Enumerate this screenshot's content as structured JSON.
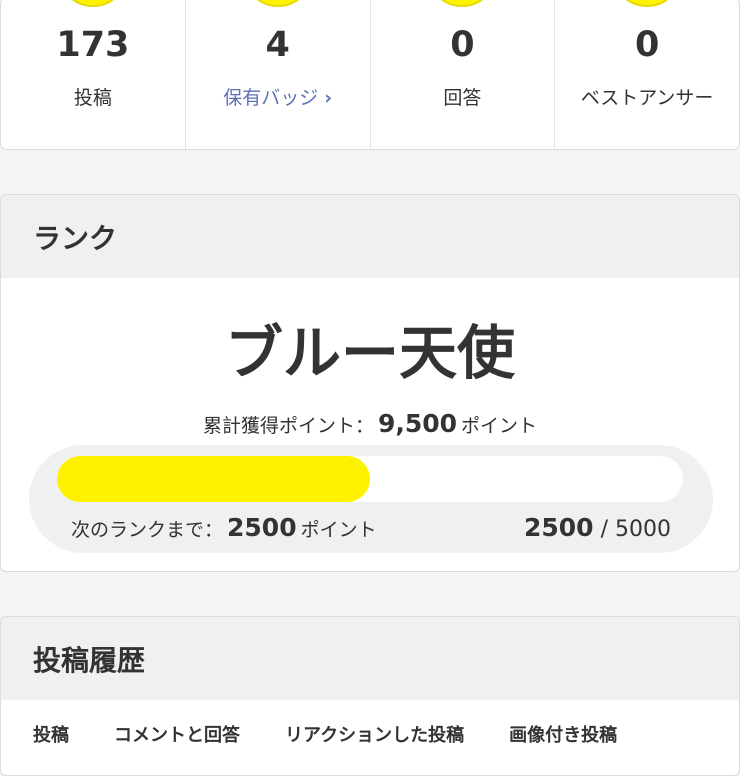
{
  "stats": [
    {
      "value": "173",
      "label": "投稿",
      "link": false
    },
    {
      "value": "4",
      "label": "保有バッジ",
      "link": true
    },
    {
      "value": "0",
      "label": "回答",
      "link": false
    },
    {
      "value": "0",
      "label": "ベストアンサー",
      "link": false
    }
  ],
  "rank": {
    "header": "ランク",
    "name": "ブルー天使",
    "total_label": "累計獲得ポイント：",
    "total_value": "9,500",
    "point_unit": "ポイント",
    "next_label": "次のランクまで：",
    "next_value": "2500",
    "progress_current": "2500",
    "progress_separator": "/",
    "progress_max": "5000",
    "progress_fraction": 0.5,
    "accent_color": "#fff200"
  },
  "history": {
    "header": "投稿履歴",
    "tabs": [
      "投稿",
      "コメントと回答",
      "リアクションした投稿",
      "画像付き投稿"
    ]
  }
}
